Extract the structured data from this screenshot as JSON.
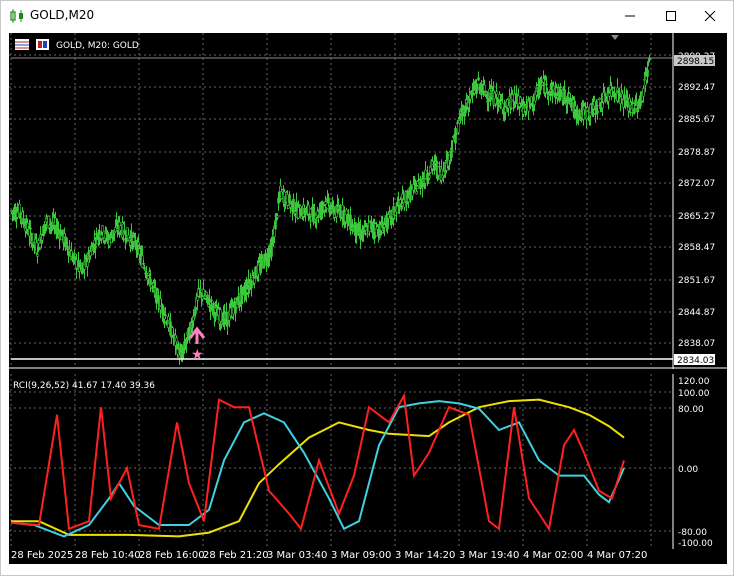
{
  "window": {
    "title": "GOLD,M20",
    "buttons": [
      "minimize",
      "maximize",
      "close"
    ]
  },
  "chart_header": {
    "symbol_label": "GOLD, M20:  GOLD"
  },
  "price_axis": {
    "labels": [
      "2899.27",
      "2892.47",
      "2885.67",
      "2878.87",
      "2872.07",
      "2865.27",
      "2858.47",
      "2851.67",
      "2844.87",
      "2838.07"
    ],
    "current_price": "2898.15",
    "horizontal_line_price": "2834.03"
  },
  "indicator": {
    "label": "RCI(9,26,52) 41.67 17.40 39.36",
    "axis_labels": [
      "120.00",
      "100.00",
      "80.00",
      "0.00",
      "-80.00",
      "-100.00"
    ]
  },
  "time_axis": {
    "labels": [
      "28 Feb 2025",
      "28 Feb 10:40",
      "28 Feb 16:00",
      "28 Feb 21:20",
      "3 Mar 03:40",
      "3 Mar 09:00",
      "3 Mar 14:20",
      "3 Mar 19:40",
      "4 Mar 02:00",
      "4 Mar 07:20"
    ]
  },
  "colors": {
    "background": "#000000",
    "grid": "#646464",
    "bull_candle": "#3cc83c",
    "rci_short": "#ff2020",
    "rci_mid": "#40d0e0",
    "rci_long": "#f0e000",
    "arrow": "#ff80c0"
  },
  "chart_data": {
    "type": "candlestick",
    "price_close_path": [
      2866,
      2862,
      2858,
      2864,
      2863,
      2860,
      2856,
      2853,
      2858,
      2862,
      2860,
      2863,
      2861,
      2859,
      2854,
      2849,
      2845,
      2840,
      2835,
      2841,
      2849,
      2847,
      2844,
      2843,
      2846,
      2849,
      2852,
      2855,
      2858,
      2870,
      2868,
      2866,
      2866,
      2865,
      2868,
      2866,
      2866,
      2863,
      2861,
      2863,
      2862,
      2864,
      2867,
      2869,
      2871,
      2873,
      2876,
      2874,
      2879,
      2886,
      2890,
      2893,
      2891,
      2890,
      2888,
      2890,
      2888,
      2889,
      2893,
      2892,
      2891,
      2890,
      2887,
      2887,
      2888,
      2890,
      2892,
      2890,
      2888,
      2889,
      2898
    ],
    "rci": {
      "period_short": 9,
      "period_mid": 26,
      "period_long": 52,
      "values_shown": [
        41.67,
        17.4,
        39.36
      ]
    }
  }
}
